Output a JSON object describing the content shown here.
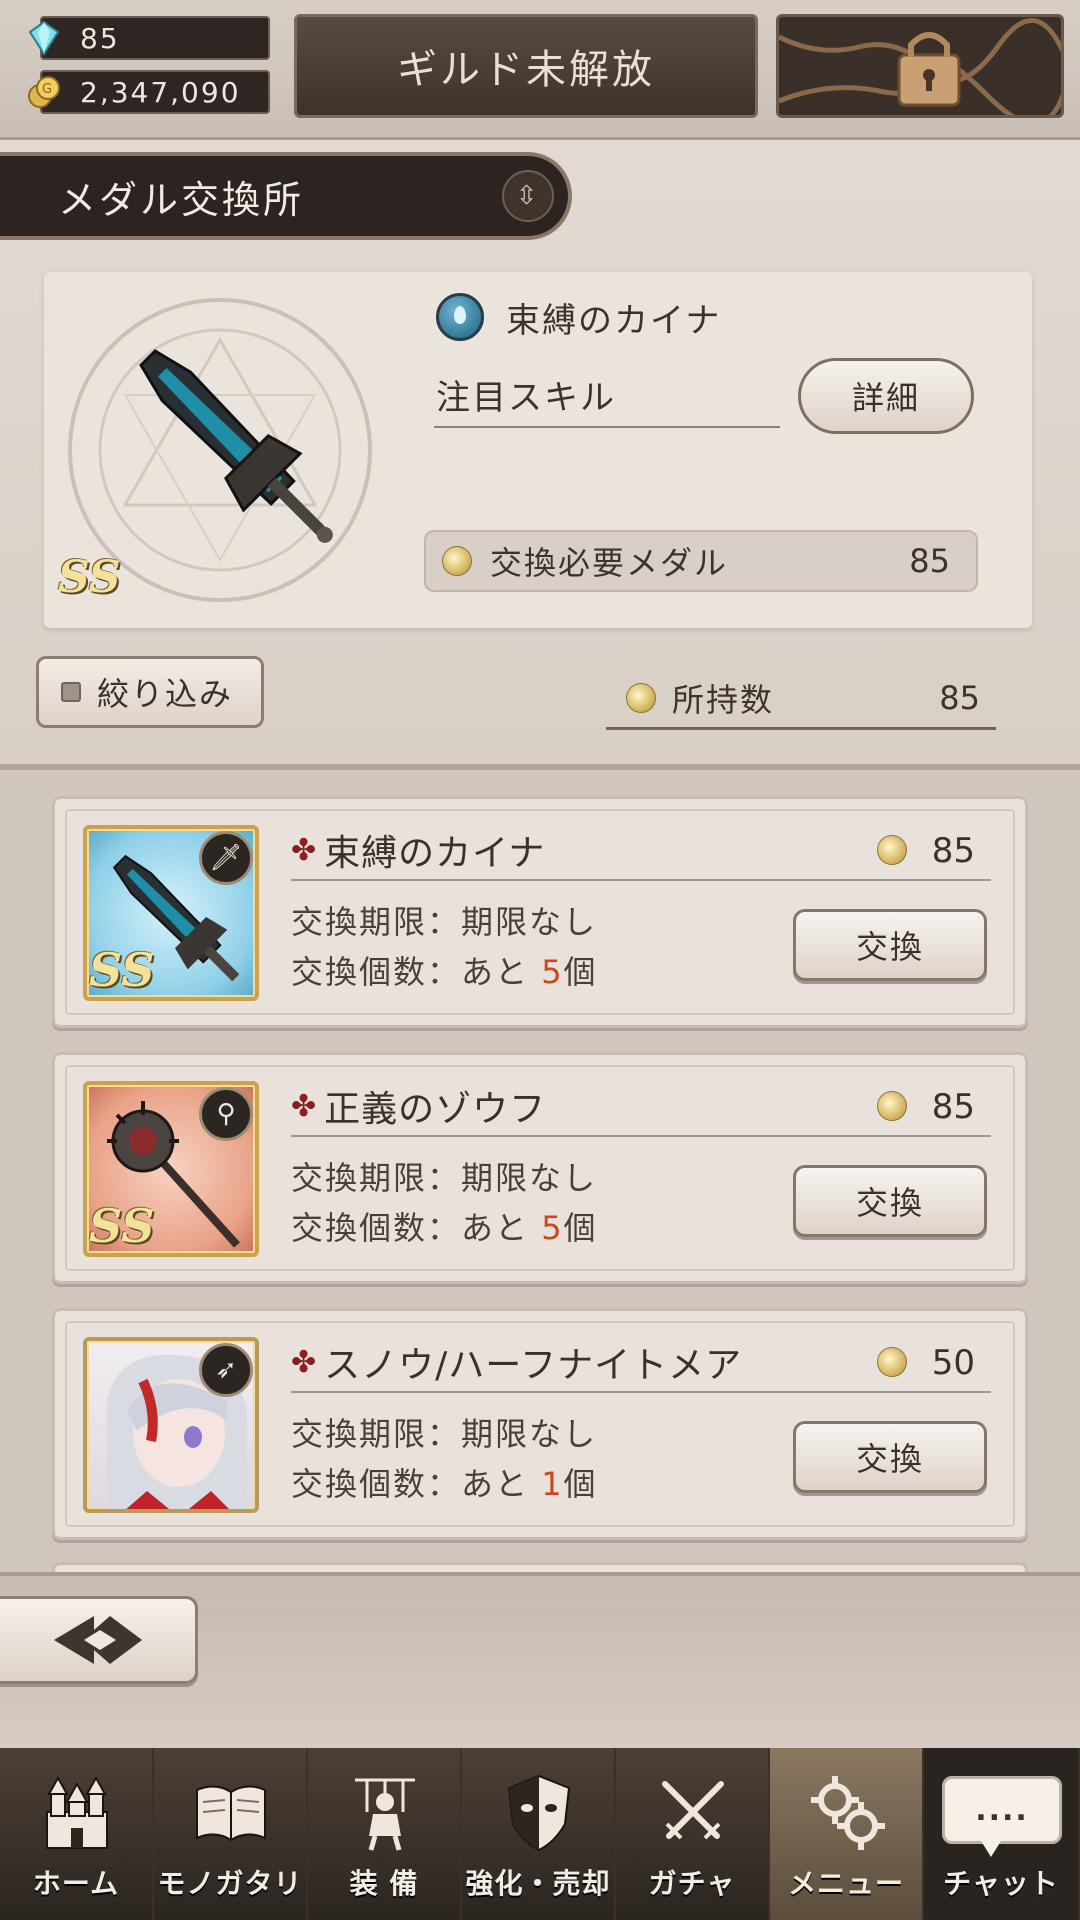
{
  "header": {
    "gems": "85",
    "gold": "2,347,090",
    "guild_button": "ギルド未解放",
    "locked_icon": "chain-lock-icon"
  },
  "section": {
    "title": "メダル交換所"
  },
  "preview": {
    "rank": "SS",
    "name": "束縛のカイナ",
    "skill_label": "注目スキル",
    "detail_button": "詳細",
    "cost_label": "交換必要メダル",
    "cost_value": "85"
  },
  "filter": {
    "label": "絞り込み"
  },
  "owned": {
    "label": "所持数",
    "value": "85"
  },
  "items": [
    {
      "name": "束縛のカイナ",
      "cost": "85",
      "rank": "SS",
      "type_icon": "sword-icon",
      "limit_text": "交換期限：期限なし",
      "count_prefix": "交換個数：あと ",
      "count_value": "5",
      "count_suffix": "個",
      "button": "交換",
      "bg": "#8fd0e8"
    },
    {
      "name": "正義のゾウフ",
      "cost": "85",
      "rank": "SS",
      "type_icon": "staff-icon",
      "limit_text": "交換期限：期限なし",
      "count_prefix": "交換個数：あと ",
      "count_value": "5",
      "count_suffix": "個",
      "button": "交換",
      "bg": "#e9a287"
    },
    {
      "name": "スノウ/ハーフナイトメア",
      "cost": "50",
      "rank": "",
      "type_icon": "bow-icon",
      "limit_text": "交換期限：期限なし",
      "count_prefix": "交換個数：あと ",
      "count_value": "1",
      "count_suffix": "個",
      "button": "交換",
      "bg": "#efe9ee"
    }
  ],
  "tabs": [
    {
      "label": "ホーム",
      "icon": "castle-icon",
      "active": false
    },
    {
      "label": "モノガタリ",
      "icon": "book-icon",
      "active": false
    },
    {
      "label": "装 備",
      "icon": "puppet-icon",
      "active": false
    },
    {
      "label": "強化・売却",
      "icon": "shield-mask-icon",
      "active": false
    },
    {
      "label": "ガチャ",
      "icon": "crossed-swords-icon",
      "active": false
    },
    {
      "label": "メニュー",
      "icon": "gears-icon",
      "active": true
    },
    {
      "label": "チャット",
      "icon": "chat-bubble-icon",
      "active": false
    }
  ],
  "chat_bubble": "....",
  "colors": {
    "remaining_accent": "#d0451b",
    "rank_gold": "#f4e29a",
    "cross_red": "#8b1f1f"
  }
}
